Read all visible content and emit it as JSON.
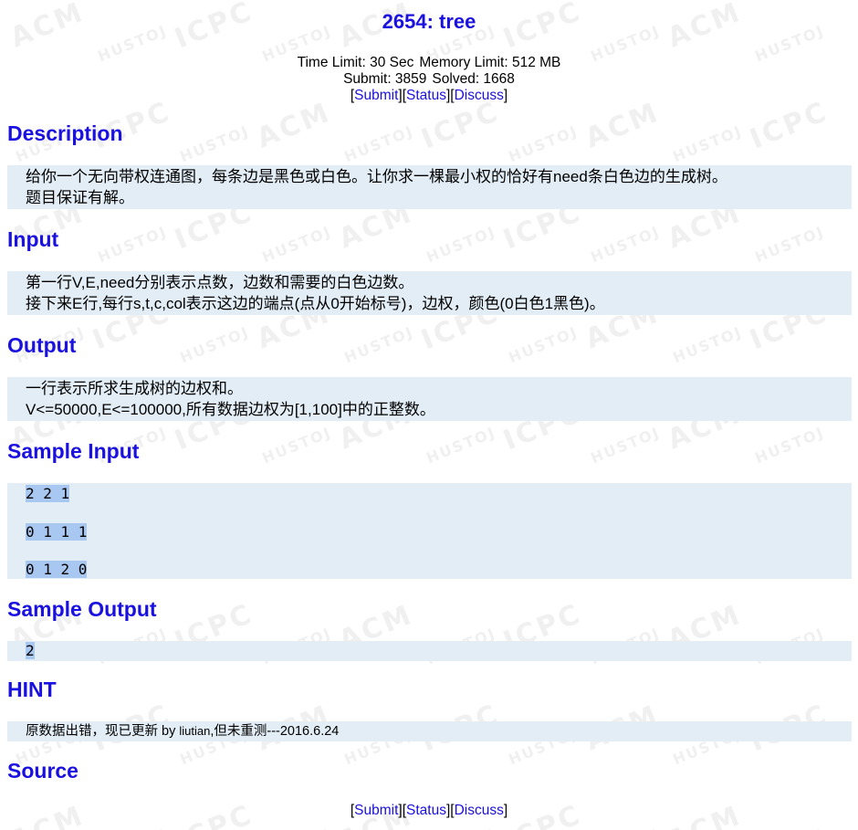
{
  "problem": {
    "title": "2654: tree",
    "time_limit": "Time Limit: 30 Sec",
    "memory_limit": "Memory Limit: 512 MB",
    "submit_count": "Submit: 3859",
    "solved_count": "Solved: 1668"
  },
  "links": {
    "submit": "Submit",
    "status": "Status",
    "discuss": "Discuss"
  },
  "sections": {
    "description": {
      "title": "Description",
      "lines": [
        "给你一个无向带权连通图，每条边是黑色或白色。让你求一棵最小权的恰好有need条白色边的生成树。",
        "题目保证有解。"
      ]
    },
    "input": {
      "title": "Input",
      "lines": [
        "第一行V,E,need分别表示点数，边数和需要的白色边数。",
        "接下来E行,每行s,t,c,col表示这边的端点(点从0开始标号)，边权，颜色(0白色1黑色)。"
      ]
    },
    "output": {
      "title": "Output",
      "lines": [
        "一行表示所求生成树的边权和。",
        "V<=50000,E<=100000,所有数据边权为[1,100]中的正整数。"
      ]
    },
    "sample_input": {
      "title": "Sample Input",
      "lines": [
        "2 2 1",
        "0 1 1 1",
        "0 1 2 0"
      ]
    },
    "sample_output": {
      "title": "Sample Output",
      "lines": [
        "2"
      ]
    },
    "hint": {
      "title": "HINT",
      "prefix": "原数据出错，现已更新 by ",
      "author": "liutian",
      "suffix": ",但未重测---2016.6.24"
    },
    "source": {
      "title": "Source"
    }
  },
  "watermark": {
    "brand_acm": "ACM",
    "brand_icpc": "ICPC",
    "brand_hustoj": "HUSTOJ"
  },
  "colors": {
    "accent": "#1a10e0",
    "box_bg": "#e2edf6",
    "highlight": "#a8c8f2"
  }
}
